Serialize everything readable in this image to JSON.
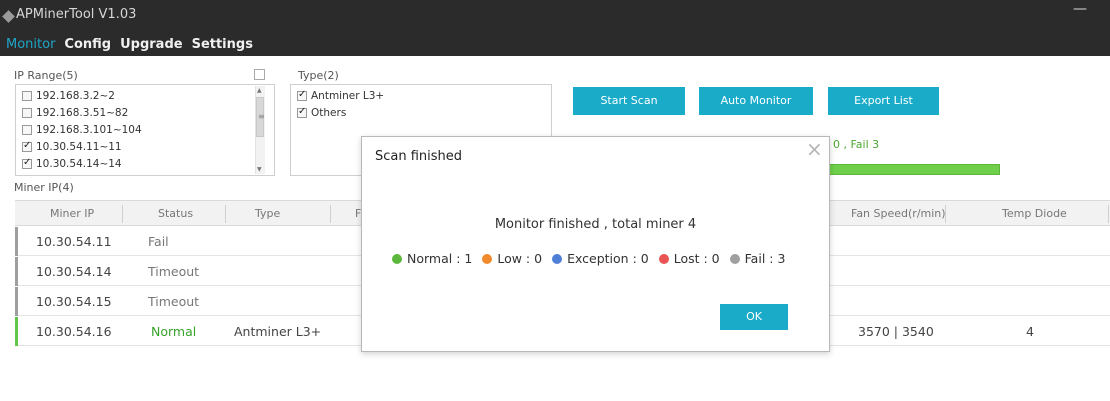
{
  "window": {
    "title": "APMinerTool V1.03"
  },
  "menu": {
    "items": [
      "Monitor",
      "Config",
      "Upgrade",
      "Settings"
    ]
  },
  "ip_range": {
    "label": "IP Range(5)",
    "items": [
      {
        "text": "192.168.3.2~2",
        "checked": false
      },
      {
        "text": "192.168.3.51~82",
        "checked": false
      },
      {
        "text": "192.168.3.101~104",
        "checked": false
      },
      {
        "text": "10.30.54.11~11",
        "checked": true
      },
      {
        "text": "10.30.54.14~14",
        "checked": true
      }
    ]
  },
  "type": {
    "label": "Type(2)",
    "items": [
      {
        "text": "Antminer L3+",
        "checked": true
      },
      {
        "text": "Others",
        "checked": true
      }
    ]
  },
  "buttons": {
    "start_scan": "Start Scan",
    "auto_monitor": "Auto Monitor",
    "export_list": "Export List"
  },
  "scan_status": "0 , Fail 3",
  "miner_list": {
    "label": "Miner IP(4)",
    "columns": [
      "Miner IP",
      "Status",
      "Type",
      "F",
      "Fan Speed(r/min)",
      "Temp Diode"
    ],
    "rows": [
      {
        "ip": "10.30.54.11",
        "status": "Fail",
        "type": "",
        "fan": "",
        "temp": ""
      },
      {
        "ip": "10.30.54.14",
        "status": "Timeout",
        "type": "",
        "fan": "",
        "temp": ""
      },
      {
        "ip": "10.30.54.15",
        "status": "Timeout",
        "type": "",
        "fan": "",
        "temp": ""
      },
      {
        "ip": "10.30.54.16",
        "status": "Normal",
        "type": "Antminer L3+",
        "fan": "3570 | 3540",
        "temp": "4"
      }
    ]
  },
  "modal": {
    "title": "Scan finished",
    "message": "Monitor finished , total miner 4",
    "legend": [
      {
        "label": "Normal : 1",
        "color": "#5cb83c"
      },
      {
        "label": "Low : 0",
        "color": "#f08a2c"
      },
      {
        "label": "Exception : 0",
        "color": "#4f7fd6"
      },
      {
        "label": "Lost : 0",
        "color": "#ea5454"
      },
      {
        "label": "Fail : 3",
        "color": "#a0a0a0"
      }
    ],
    "ok": "OK"
  },
  "colors": {
    "accent": "#1aabc9",
    "titlebar": "#2b2b2b",
    "normal": "#38a32a"
  }
}
